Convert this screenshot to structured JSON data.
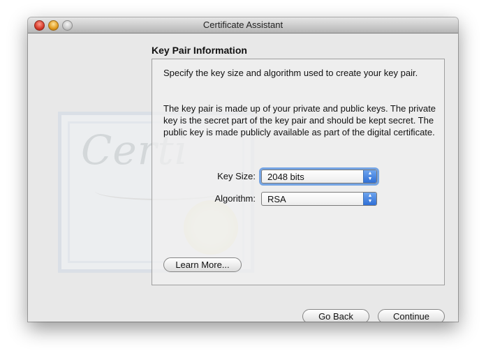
{
  "window": {
    "title": "Certificate Assistant"
  },
  "background_art": {
    "script_text": "Certi"
  },
  "page": {
    "heading": "Key Pair Information",
    "paragraph1": "Specify the key size and algorithm used to create your key pair.",
    "paragraph2": "The key pair is made up of your private and public keys. The private key is the secret part of the key pair and should be kept secret. The public key is made publicly available as part of the digital certificate."
  },
  "fields": {
    "key_size": {
      "label": "Key Size:",
      "value": "2048 bits"
    },
    "algorithm": {
      "label": "Algorithm:",
      "value": "RSA"
    }
  },
  "buttons": {
    "learn_more": "Learn More...",
    "go_back": "Go Back",
    "continue": "Continue"
  },
  "icons": {
    "close": "close-traffic-light-icon",
    "minimize": "minimize-traffic-light-icon",
    "zoom": "zoom-traffic-light-icon",
    "popup_arrows": "up-down-arrows-icon"
  },
  "colors": {
    "focus_ring": "#5f96e1",
    "popup_arrow": "#2f6fd6"
  }
}
